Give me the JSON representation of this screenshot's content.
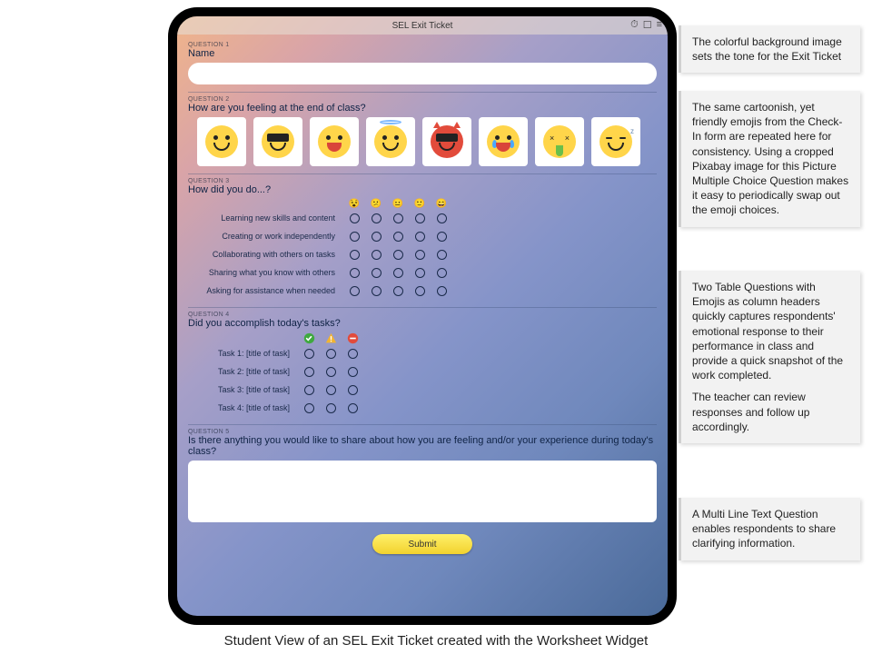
{
  "app_title": "SEL Exit Ticket",
  "q1": {
    "label": "QUESTION 1",
    "title": "Name"
  },
  "q2": {
    "label": "QUESTION 2",
    "title": "How are you feeling at the end of class?",
    "emoji_names": [
      "smiling",
      "cool-sunglasses",
      "laughing",
      "angel",
      "devil",
      "crying",
      "sick",
      "sleepy"
    ]
  },
  "q3": {
    "label": "QUESTION 3",
    "title": "How did you do...?",
    "col_emojis": [
      "😵",
      "😕",
      "😐",
      "🙂",
      "😄"
    ],
    "rows": [
      "Learning new skills and content",
      "Creating or work independently",
      "Collaborating with others on tasks",
      "Sharing what you know with others",
      "Asking for assistance when needed"
    ]
  },
  "q4": {
    "label": "QUESTION 4",
    "title": "Did you accomplish today's tasks?",
    "col_icons": [
      "done",
      "partial",
      "not-done"
    ],
    "rows": [
      "Task 1: [title of task]",
      "Task 2: [title of task]",
      "Task 3: [title of task]",
      "Task 4: [title of task]"
    ]
  },
  "q5": {
    "label": "QUESTION 5",
    "title": "Is there anything you would like to share about how you are feeling and/or your experience during today's class?"
  },
  "submit_label": "Submit",
  "callouts": {
    "c1": "The colorful background image sets the tone for the Exit Ticket",
    "c2": "The same cartoonish, yet friendly emojis from the Check-In form are repeated here for consistency. Using a cropped Pixabay image for this Picture Multiple Choice Question makes it easy to periodically swap out the emoji choices.",
    "c3a": "Two Table Questions with Emojis as column headers quickly captures respondents' emotional response to their performance in class and provide a quick snapshot of the work completed.",
    "c3b": "The teacher can review responses and follow up accordingly.",
    "c4": "A Multi Line Text Question enables respondents to share clarifying information."
  },
  "caption": "Student View of an SEL Exit Ticket created with the Worksheet Widget"
}
